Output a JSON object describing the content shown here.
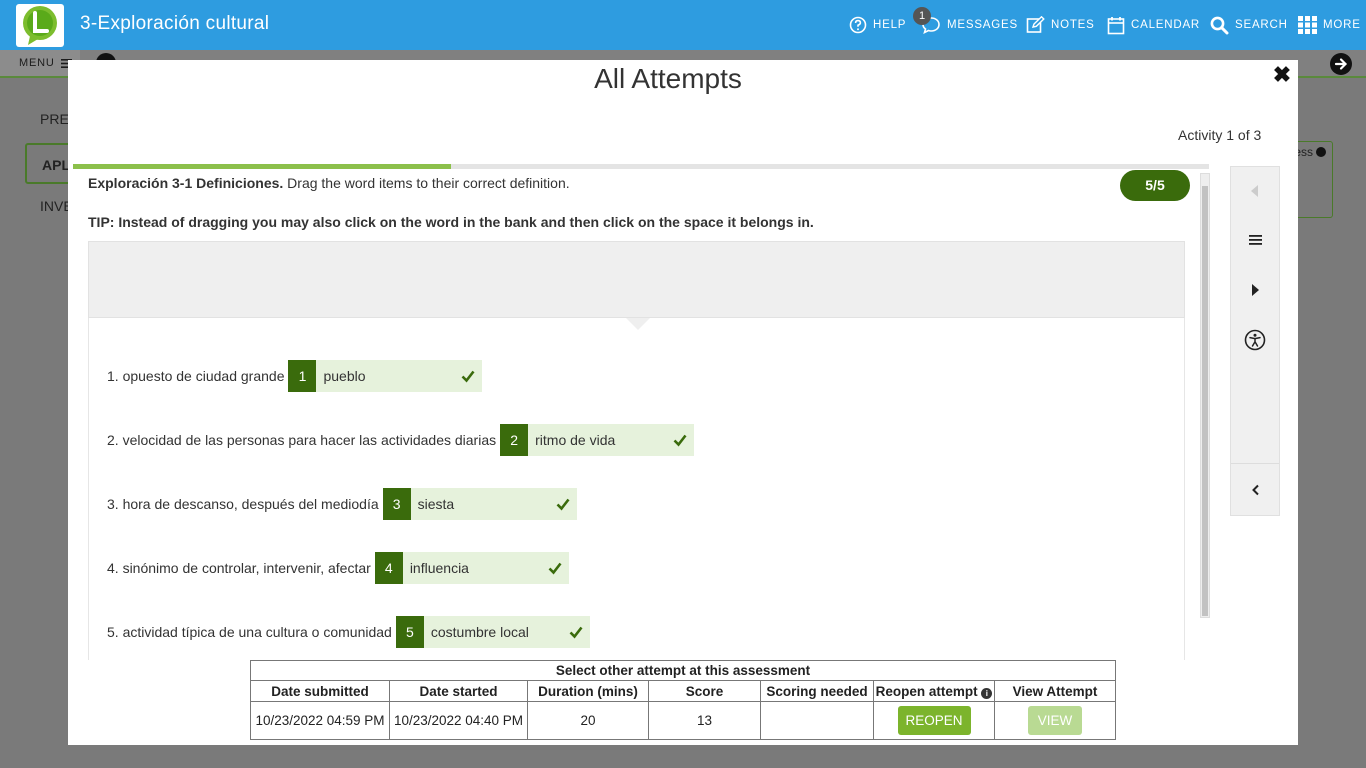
{
  "app": {
    "title": "3-Exploración cultural"
  },
  "nav": {
    "help": "HELP",
    "messages": "MESSAGES",
    "messages_count": "1",
    "notes": "NOTES",
    "calendar": "CALENDAR",
    "search": "SEARCH",
    "more": "MORE"
  },
  "subbar": {
    "menu_label": "MENU"
  },
  "background": {
    "side_items": [
      "PREI",
      "APL",
      "INVE"
    ],
    "right_card_text": "ess"
  },
  "modal": {
    "title": "All Attempts",
    "activity_counter": "Activity 1 of 3",
    "progress_fraction": 0.333,
    "instructions_bold": "Exploración 3-1 Definiciones.",
    "instructions_text": "Drag the word items to their correct definition.",
    "score": "5/5",
    "tip": "TIP: Instead of dragging you may also click on the word in the bank and then click on the space it belongs in.",
    "questions": [
      {
        "text": "1. opuesto de ciudad grande",
        "num": "1",
        "answer": "pueblo"
      },
      {
        "text": "2. velocidad de las personas para hacer las actividades diarias",
        "num": "2",
        "answer": "ritmo de vida"
      },
      {
        "text": "3. hora de descanso, después del mediodía",
        "num": "3",
        "answer": "siesta"
      },
      {
        "text": "4. sinónimo de controlar, intervenir, afectar",
        "num": "4",
        "answer": "influencia"
      },
      {
        "text": "5. actividad típica de una cultura o comunidad",
        "num": "5",
        "answer": "costumbre local"
      }
    ]
  },
  "attempts_table": {
    "caption": "Select other attempt at this assessment",
    "headers": [
      "Date submitted",
      "Date started",
      "Duration (mins)",
      "Score",
      "Scoring needed",
      "Reopen  attempt",
      "View Attempt"
    ],
    "row": {
      "date_submitted": "10/23/2022 04:59 PM",
      "date_started": "10/23/2022 04:40 PM",
      "duration": "20",
      "score": "13",
      "scoring_needed": "",
      "reopen_label": "REOPEN",
      "view_label": "VIEW"
    }
  },
  "colors": {
    "topbar": "#2e9ce0",
    "brand_green": "#3a6b0c",
    "progress_green": "#8cc04b",
    "reopen_green": "#7cb42c"
  }
}
